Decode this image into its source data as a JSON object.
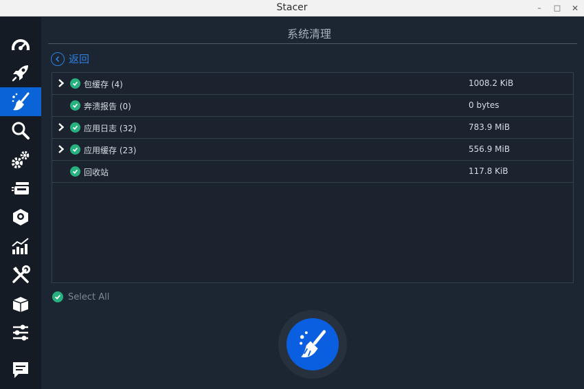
{
  "window": {
    "title": "Stacer",
    "controls": {
      "minimize": "–",
      "maximize": "□",
      "close": "✕"
    }
  },
  "sidebar": {
    "active_color": "#0a64d8",
    "items": [
      {
        "icon": "dashboard-gauge-icon",
        "active": false
      },
      {
        "icon": "rocket-icon",
        "active": false
      },
      {
        "icon": "broom-icon",
        "active": true
      },
      {
        "icon": "search-icon",
        "active": false
      },
      {
        "icon": "gears-icon",
        "active": false
      },
      {
        "icon": "services-icon",
        "active": false
      },
      {
        "icon": "uninstaller-box-icon",
        "active": false
      },
      {
        "icon": "resources-chart-icon",
        "active": false
      },
      {
        "icon": "tools-icon",
        "active": false
      },
      {
        "icon": "package-box-icon",
        "active": false
      },
      {
        "icon": "settings-sliders-icon",
        "active": false
      },
      {
        "icon": "feedback-chat-icon",
        "active": false
      }
    ]
  },
  "main": {
    "title": "系统清理",
    "back_label": "返回",
    "rows": [
      {
        "name": "包缓存 (4)",
        "size": "1008.2 KiB",
        "expandable": true,
        "checked": true
      },
      {
        "name": "奔溃报告 (0)",
        "size": "0 bytes",
        "expandable": false,
        "checked": true
      },
      {
        "name": "应用日志 (32)",
        "size": "783.9 MiB",
        "expandable": true,
        "checked": true
      },
      {
        "name": "应用缓存 (23)",
        "size": "556.9 MiB",
        "expandable": true,
        "checked": true
      },
      {
        "name": "回收站",
        "size": "117.8 KiB",
        "expandable": false,
        "checked": true
      }
    ],
    "select_all_label": "Select All",
    "check_color": "#29b07f",
    "accent_color": "#0a5fe0"
  }
}
